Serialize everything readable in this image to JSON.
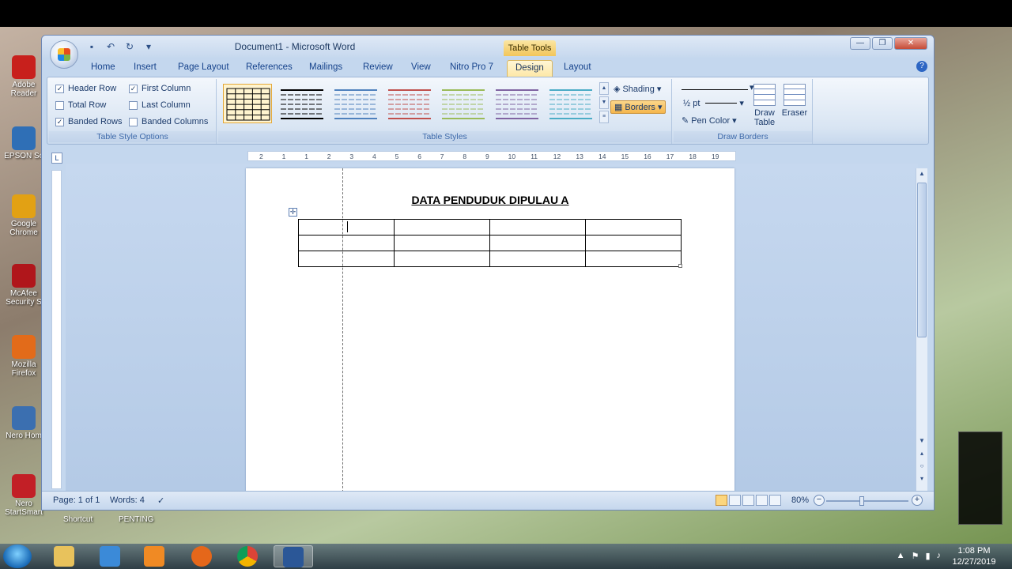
{
  "window": {
    "title": "Document1 - Microsoft Word",
    "contextual_title": "Table Tools",
    "controls": {
      "minimize": "—",
      "restore": "❐",
      "close": "✕"
    }
  },
  "desktop": {
    "icons": [
      {
        "label": "Adobe Reader",
        "color": "#c8201c",
        "lines": [
          "Adobe",
          "Reader"
        ]
      },
      {
        "label": "EPSON Sc",
        "color": "#2f6fb6",
        "lines": [
          "EPSON Sc",
          ""
        ]
      },
      {
        "label": "Google Chrome",
        "color": "#e2a114",
        "lines": [
          "Google",
          "Chrome"
        ]
      },
      {
        "label": "McAfee Security S",
        "color": "#b0161b",
        "lines": [
          "McAfee",
          "Security S"
        ]
      },
      {
        "label": "Mozilla Firefox",
        "color": "#e26b1a",
        "lines": [
          "Mozilla",
          "Firefox"
        ]
      },
      {
        "label": "Nero Home",
        "color": "#3b6fb0",
        "lines": [
          "Nero Hom",
          ""
        ]
      },
      {
        "label": "Nero StartSmart",
        "color": "#c21f26",
        "lines": [
          "Nero",
          "StartSmart"
        ]
      }
    ],
    "bottom_labels": [
      "Shortcut",
      "PENTING"
    ]
  },
  "tabs": [
    "Home",
    "Insert",
    "Page Layout",
    "References",
    "Mailings",
    "Review",
    "View",
    "Nitro Pro 7",
    "Design",
    "Layout"
  ],
  "active_tab": "Design",
  "ribbon": {
    "table_style_options": {
      "label": "Table Style Options",
      "options": [
        {
          "label": "Header Row",
          "checked": true
        },
        {
          "label": "Total Row",
          "checked": false
        },
        {
          "label": "Banded Rows",
          "checked": true
        },
        {
          "label": "First Column",
          "checked": true
        },
        {
          "label": "Last Column",
          "checked": false
        },
        {
          "label": "Banded Columns",
          "checked": false
        }
      ]
    },
    "table_styles": {
      "label": "Table Styles",
      "swatch_colors": [
        "#000000",
        "#000000",
        "#4f81bd",
        "#c0504d",
        "#9bbb59",
        "#8064a2",
        "#4bacc6"
      ],
      "shading": "Shading",
      "borders": "Borders"
    },
    "draw_borders": {
      "label": "Draw Borders",
      "pen_weight": "½ pt",
      "pen_color": "Pen Color",
      "draw_table": "Draw Table",
      "eraser": "Eraser"
    }
  },
  "ruler": {
    "h_numbers": [
      "2",
      "1",
      "1",
      "2",
      "3",
      "4",
      "5",
      "6",
      "7",
      "8",
      "9",
      "10",
      "11",
      "12",
      "13",
      "14",
      "15",
      "16",
      "17",
      "18",
      "19"
    ]
  },
  "document": {
    "heading": "DATA PENDUDUK DIPULAU A",
    "table": {
      "rows": 3,
      "cols": 4
    }
  },
  "status": {
    "page": "Page: 1 of 1",
    "words": "Words: 4",
    "zoom": "80%"
  },
  "taskbar": {
    "time": "1:08 PM",
    "date": "12/27/2019"
  }
}
